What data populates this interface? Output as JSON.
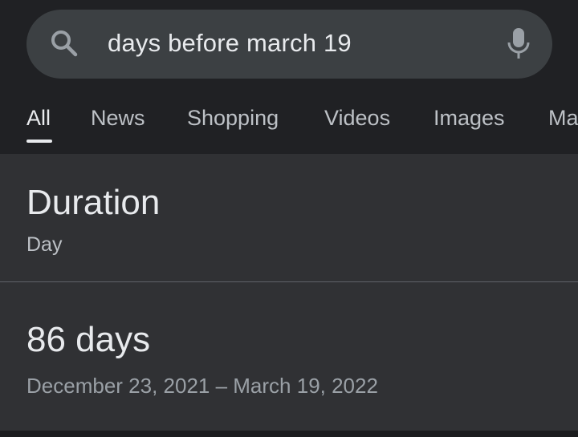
{
  "search": {
    "query": "days before march 19",
    "icon": "search-icon",
    "mic_icon": "mic-icon"
  },
  "tabs": [
    {
      "label": "All",
      "active": true
    },
    {
      "label": "News",
      "active": false
    },
    {
      "label": "Shopping",
      "active": false
    },
    {
      "label": "Videos",
      "active": false
    },
    {
      "label": "Images",
      "active": false
    },
    {
      "label": "Ma",
      "active": false
    }
  ],
  "calculator": {
    "title": "Duration",
    "unit": "Day",
    "result": "86 days",
    "range": "December 23, 2021 – March 19, 2022"
  },
  "colors": {
    "background": "#202124",
    "search_bar": "#3c4043",
    "card": "#303134",
    "text_primary": "#e8eaed",
    "text_secondary": "#9aa0a6"
  }
}
